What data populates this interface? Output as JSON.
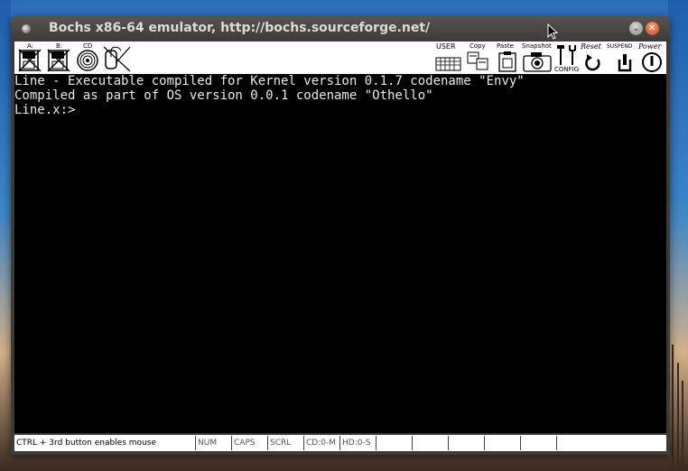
{
  "window": {
    "title": "Bochs x86-64 emulator, http://bochs.sourceforge.net/"
  },
  "toolbar": {
    "floppy_a_label": "A:",
    "floppy_b_label": "B:",
    "cdrom_label": "CD",
    "user_label": "USER",
    "copy_label": "Copy",
    "paste_label": "Paste",
    "snapshot_label": "Snapshot",
    "config_label": "CONFIG",
    "reset_label": "Reset",
    "suspend_label": "SUSPEND",
    "power_label": "Power",
    "icons": [
      "floppy-a-icon",
      "floppy-b-icon",
      "cdrom-icon",
      "mouse-icon",
      "user-keyboard-icon",
      "copy-icon",
      "paste-icon",
      "snapshot-camera-icon",
      "config-icon",
      "reset-icon",
      "suspend-icon",
      "power-icon"
    ]
  },
  "console": {
    "lines": [
      "Line - Executable compiled for Kernel version 0.1.7 codename \"Envy\"",
      "Compiled as part of OS version 0.0.1 codename \"Othello\"",
      "Line.x:>"
    ]
  },
  "statusbar": {
    "message": "CTRL + 3rd button enables mouse",
    "num": "NUM",
    "caps": "CAPS",
    "scrl": "SCRL",
    "cd": "CD:0-M",
    "hd": "HD:0-S"
  }
}
